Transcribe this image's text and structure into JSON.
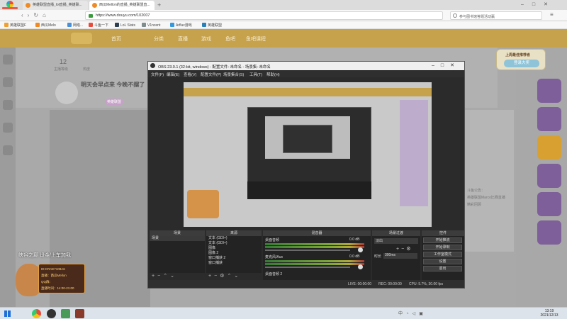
{
  "browser": {
    "logo_text": "",
    "tabs": [
      {
        "label": "英雄联盟直播_lol直播_英雄联..."
      },
      {
        "label": "西瓜Mellon的直播_英雄联盟直..."
      }
    ],
    "url": "https://www.douyu.com/102007",
    "search_hint": "参与图书馆答题活动赢",
    "bookmarks": [
      "英雄联盟F",
      "西瓜Melo",
      "网络...",
      "斗鱼一下",
      "LoL Stats",
      "V1ncent",
      "Arflux游戏",
      "英雄联盟"
    ]
  },
  "douyu": {
    "nav": [
      "首页",
      "分类",
      "直播",
      "游戏",
      "鱼吧",
      "鱼吧课程"
    ],
    "room_stats": {
      "level": "12",
      "level_label": "主播等级",
      "hot_label": "热度"
    },
    "room_title": "明天会早点来 今晚不摆了",
    "tag": "英雄联盟",
    "right_popup": {
      "title": "上周最佳推荐者",
      "button": "登录大奖"
    },
    "chat_lines": [
      "斗鱼公告：",
      "英雄联盟Marco比赛直播",
      "精彩回顾"
    ]
  },
  "obs": {
    "title": "OBS 23.0.1 (32-bit, windows) - 配置文件: 未命名 - 场景集: 未命名",
    "menu": [
      "文件(F)",
      "编辑(E)",
      "查看(V)",
      "配置文件(P)",
      "场景集合(S)",
      "工具(T)",
      "帮助(H)"
    ],
    "docks": {
      "scenes": {
        "title": "场景",
        "items": [
          "场景"
        ]
      },
      "sources": {
        "title": "来源",
        "items": [
          "文本 (GDI+)",
          "文本 (GDI+)",
          "图像",
          "图像 2",
          "窗口捕获 2",
          "窗口捕获"
        ]
      },
      "mixer": {
        "title": "混音器",
        "tracks": [
          {
            "name": "桌面音频",
            "db": "0.0 dB"
          },
          {
            "name": "麦克风/Aux",
            "db": "0.0 dB"
          },
          {
            "name": "桌面音频 2",
            "db": ""
          }
        ]
      },
      "transitions": {
        "title": "场景过渡",
        "mode": "淡出",
        "duration_label": "时长",
        "duration": "300ms"
      },
      "controls": {
        "title": "控件",
        "buttons": [
          "开始推流",
          "开始录制",
          "工作室模式",
          "设置",
          "退出"
        ]
      }
    },
    "status": {
      "live": "LIVE: 00:00:00",
      "rec": "REC: 00:00:00",
      "cpu": "CPU: 5.7%, 30.00 fps"
    }
  },
  "overlay": {
    "text": "峡谷之巅 设金/上车加我",
    "info_lines": [
      "ID:CRAE7108A6",
      "直播：西瓜Mellon",
      "QQ群：",
      "直播时间：14:00-21:00"
    ]
  },
  "taskbar": {
    "time": "13:19",
    "date": "2021/12/13"
  }
}
